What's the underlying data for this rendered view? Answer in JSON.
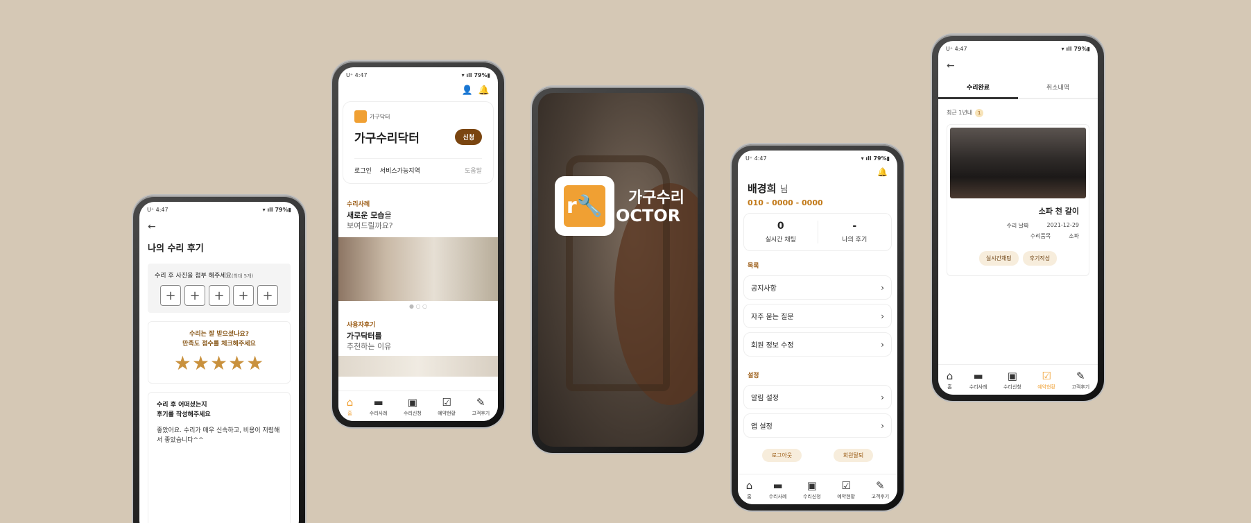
{
  "status": {
    "time": "4:47",
    "carrier": "U⁺",
    "battery": "79%"
  },
  "review": {
    "title": "나의 수리 후기",
    "photo_label": "수리 후 사진을 첨부 해주세요",
    "photo_limit": "(최대 5개)",
    "plus": [
      "+",
      "+",
      "+",
      "+",
      "+"
    ],
    "rating_q1": "수리는 잘 받으셨나요?",
    "rating_q2": "만족도 점수를 체크해주세요",
    "stars": "★★★★★",
    "review_q1": "수리 후 어떠셨는지",
    "review_q2": "후기를 작성해주세요",
    "review_text": "좋았어요. 수리가 매우 신속하고, 비용이 저렴해서 좋았습니다^^"
  },
  "home": {
    "brand_small": "가구닥터",
    "brand_name": "가구수리닥터",
    "apply": "신청",
    "login": "로그인",
    "service_area": "서비스가능지역",
    "help": "도움말",
    "cases_label": "수리사례",
    "cases_title_bold": "새로운 모습",
    "cases_title_rest": "을",
    "cases_title2": "보여드릴까요?",
    "dots": "● ○ ○",
    "reviews_label": "사용자후기",
    "reviews_title1": "가구닥터를",
    "reviews_title2": "추천하는 이유"
  },
  "splash": {
    "ko": "가구수리",
    "en": "OCTOR"
  },
  "tabs": [
    {
      "icon": "⌂",
      "label": "홈"
    },
    {
      "icon": "▬",
      "label": "수리사례"
    },
    {
      "icon": "▣",
      "label": "수리신청"
    },
    {
      "icon": "☑",
      "label": "예약현황"
    },
    {
      "icon": "✎",
      "label": "고객후기"
    }
  ],
  "mypage": {
    "name": "배경희",
    "suffix": "님",
    "phone": "010 - 0000 - 0000",
    "chat_count": "0",
    "chat_label": "실시간 채팅",
    "review_count": "-",
    "review_label": "나의 후기",
    "list_label": "목록",
    "notice": "공지사항",
    "faq": "자주 묻는 질문",
    "edit": "회원 정보 수정",
    "settings_label": "설정",
    "alarm": "알림 설정",
    "app": "앱 설정",
    "logout": "로그아웃",
    "withdraw": "회원탈퇴"
  },
  "history": {
    "tab_done": "수리완료",
    "tab_cancel": "취소내역",
    "recent": "최근 1년내",
    "count": "1",
    "item_title": "소파 천 갈이",
    "date_label": "수리 날짜",
    "date": "2021-12-29",
    "item_label": "수리품목",
    "item": "소파",
    "chat_btn": "실시간채팅",
    "review_btn": "후기작성"
  },
  "colors": {
    "background": "#d5c8b5",
    "accent": "#f0a033",
    "brown": "#7a4510"
  }
}
